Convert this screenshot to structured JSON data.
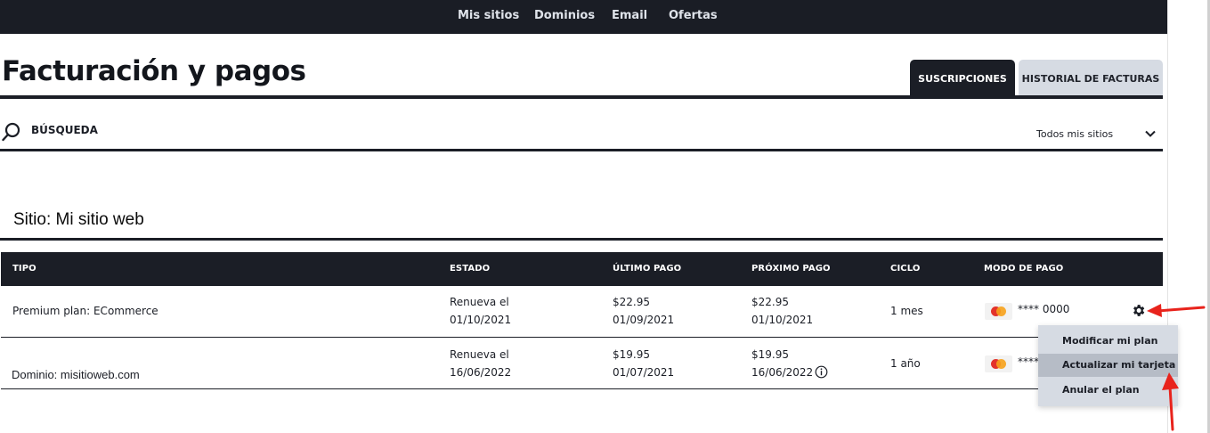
{
  "nav": {
    "items": [
      "Mis sitios",
      "Dominios",
      "Email",
      "Ofertas"
    ]
  },
  "page": {
    "title": "Facturación y pagos"
  },
  "tabs": {
    "active": "SUSCRIPCIONES",
    "inactive": "HISTORIAL DE FACTURAS"
  },
  "search": {
    "label": "BÚSQUEDA",
    "filter_value": "Todos mis sitios"
  },
  "site": {
    "heading": "Sitio: Mi sitio web"
  },
  "table": {
    "headers": [
      "TIPO",
      "ESTADO",
      "ÚLTIMO PAGO",
      "PRÓXIMO PAGO",
      "CICLO",
      "MODO DE PAGO"
    ],
    "rows": [
      {
        "tipo": "Premium plan: ECommerce",
        "estado_1": "Renueva el",
        "estado_2": "01/10/2021",
        "ultimo_1": "$22.95",
        "ultimo_2": "01/09/2021",
        "proximo_1": "$22.95",
        "proximo_2": "01/10/2021",
        "ciclo": "1 mes",
        "pago": "**** 0000"
      },
      {
        "tipo": "Dominio: misitioweb.com",
        "estado_1": "Renueva el",
        "estado_2": "16/06/2022",
        "ultimo_1": "$19.95",
        "ultimo_2": "01/07/2021",
        "proximo_1": "$19.95",
        "proximo_2": "16/06/2022",
        "ciclo": "1 año",
        "pago": "****"
      }
    ]
  },
  "menu": {
    "items": [
      "Modificar mi plan",
      "Actualizar mi tarjeta",
      "Anular el plan"
    ],
    "highlighted_index": 1
  },
  "colors": {
    "dark": "#1b1e26",
    "tab_inactive": "#d6dbe3",
    "menu_bg": "#d6dbe3",
    "menu_hover": "#b6bcc6",
    "annotation_arrow": "#e8231c"
  }
}
